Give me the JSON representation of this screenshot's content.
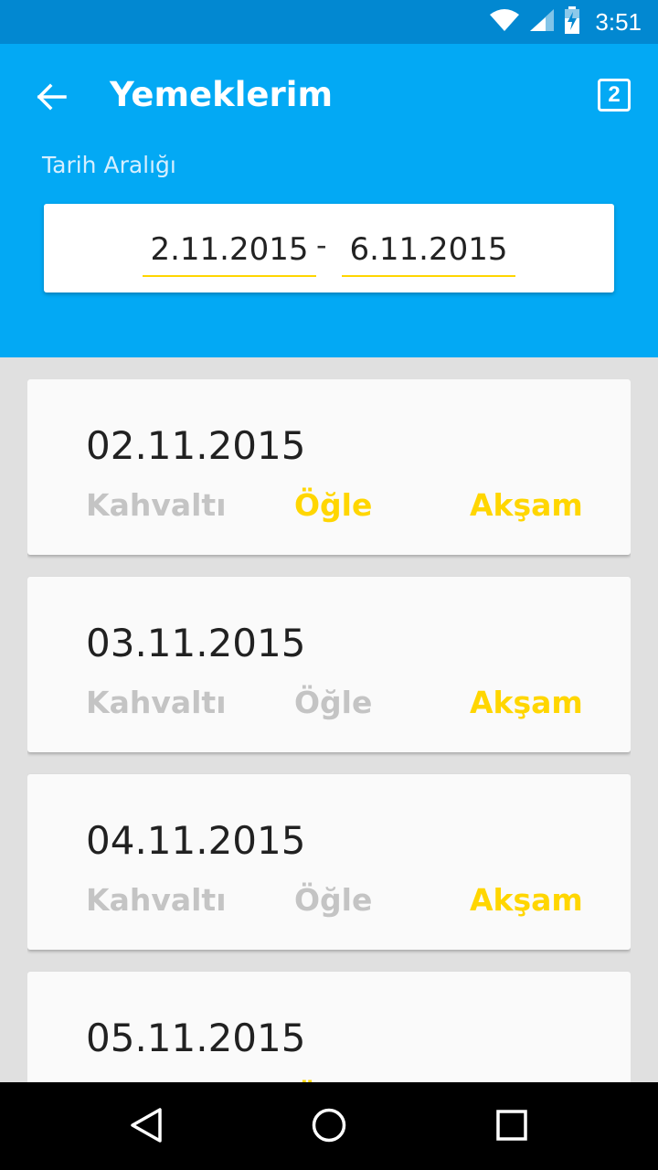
{
  "status_bar": {
    "time": "3:51",
    "icons": [
      "wifi-icon",
      "signal-icon",
      "battery-charging-icon"
    ]
  },
  "app_bar": {
    "title": "Yemeklerim",
    "back_icon": "arrow-back-icon",
    "badge_count": "2",
    "range_label": "Tarih Aralığı"
  },
  "date_range": {
    "start": "2.11.2015",
    "separator": "-",
    "end": "6.11.2015"
  },
  "meal_labels": {
    "breakfast": "Kahvaltı",
    "lunch": "Öğle",
    "dinner": "Akşam"
  },
  "days": [
    {
      "date": "02.11.2015",
      "breakfast": false,
      "lunch": true,
      "dinner": true
    },
    {
      "date": "03.11.2015",
      "breakfast": false,
      "lunch": false,
      "dinner": true
    },
    {
      "date": "04.11.2015",
      "breakfast": false,
      "lunch": false,
      "dinner": true
    },
    {
      "date": "05.11.2015",
      "breakfast": false,
      "lunch": true,
      "dinner": true
    }
  ],
  "colors": {
    "primary": "#03a9f4",
    "primary_dark": "#0288d1",
    "accent": "#ffd600",
    "inactive": "#c4c4c4"
  },
  "nav_bar": {
    "icons": [
      "back-triangle-icon",
      "home-circle-icon",
      "recents-square-icon"
    ]
  }
}
